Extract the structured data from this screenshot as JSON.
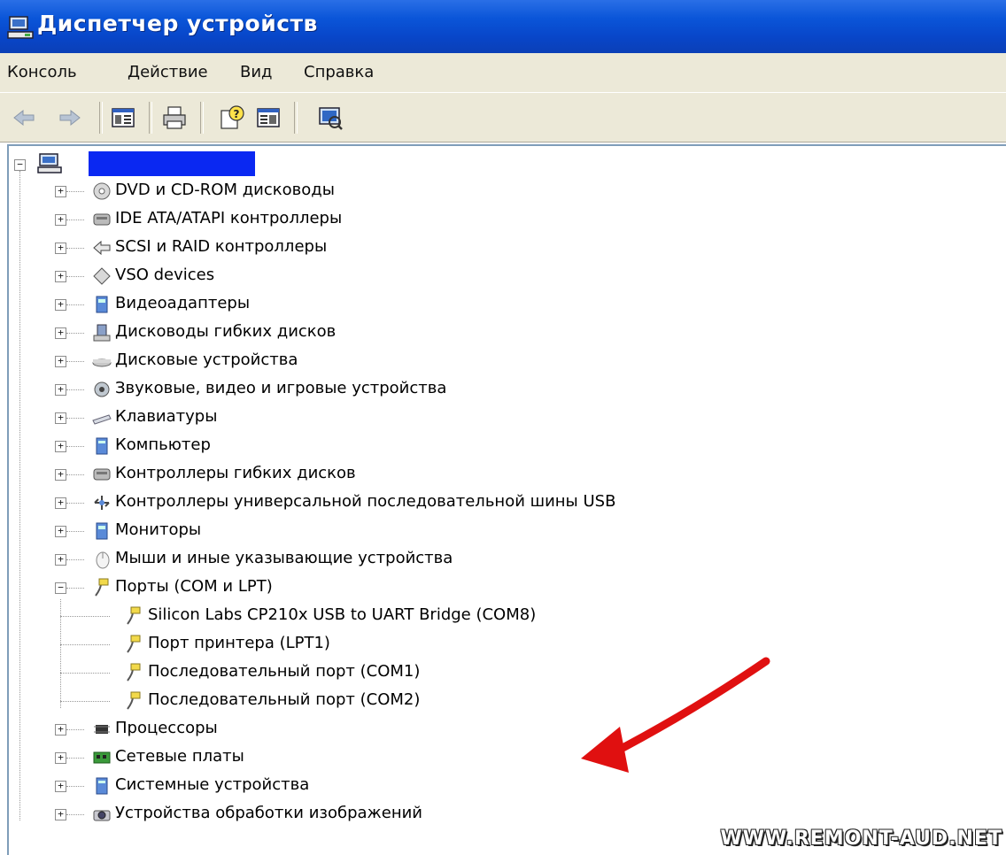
{
  "window": {
    "title": "Диспетчер устройств"
  },
  "menu": [
    "Консоль",
    "Действие",
    "Вид",
    "Справка"
  ],
  "toolbar": [
    "back-icon",
    "forward-icon",
    "properties-icon",
    "print-icon",
    "help-icon",
    "view-icon",
    "scan-hardware-icon"
  ],
  "tree": {
    "root_label": "",
    "categories": [
      {
        "label": "DVD и CD-ROM дисководы",
        "icon": "cdrom-icon"
      },
      {
        "label": "IDE ATA/ATAPI контроллеры",
        "icon": "ide-controller-icon"
      },
      {
        "label": "SCSI и RAID контроллеры",
        "icon": "scsi-icon"
      },
      {
        "label": "VSO devices",
        "icon": "vso-device-icon"
      },
      {
        "label": "Видеоадаптеры",
        "icon": "display-adapter-icon"
      },
      {
        "label": "Дисководы гибких дисков",
        "icon": "floppy-drive-icon"
      },
      {
        "label": "Дисковые устройства",
        "icon": "disk-drive-icon"
      },
      {
        "label": "Звуковые, видео и игровые устройства",
        "icon": "sound-icon"
      },
      {
        "label": "Клавиатуры",
        "icon": "keyboard-icon"
      },
      {
        "label": "Компьютер",
        "icon": "computer-icon"
      },
      {
        "label": "Контроллеры гибких дисков",
        "icon": "floppy-controller-icon"
      },
      {
        "label": "Контроллеры универсальной последовательной шины USB",
        "icon": "usb-icon"
      },
      {
        "label": "Мониторы",
        "icon": "monitor-icon"
      },
      {
        "label": "Мыши и иные указывающие устройства",
        "icon": "mouse-icon"
      },
      {
        "label": "Порты (COM и LPT)",
        "icon": "port-icon",
        "expanded": true,
        "children": [
          "Silicon Labs CP210x USB to UART Bridge (COM8)",
          "Порт принтера (LPT1)",
          "Последовательный порт (COM1)",
          "Последовательный порт (COM2)"
        ]
      },
      {
        "label": "Процессоры",
        "icon": "processor-icon"
      },
      {
        "label": "Сетевые платы",
        "icon": "network-card-icon"
      },
      {
        "label": "Системные устройства",
        "icon": "system-devices-icon"
      },
      {
        "label": "Устройства обработки изображений",
        "icon": "imaging-device-icon"
      }
    ]
  },
  "watermark": "WWW.REMONT-AUD.NET",
  "colors": {
    "titlebar": "#0a55d8",
    "menubar": "#ece9d8",
    "selection_blue": "#0a28f2",
    "arrow_red": "#e01010"
  }
}
